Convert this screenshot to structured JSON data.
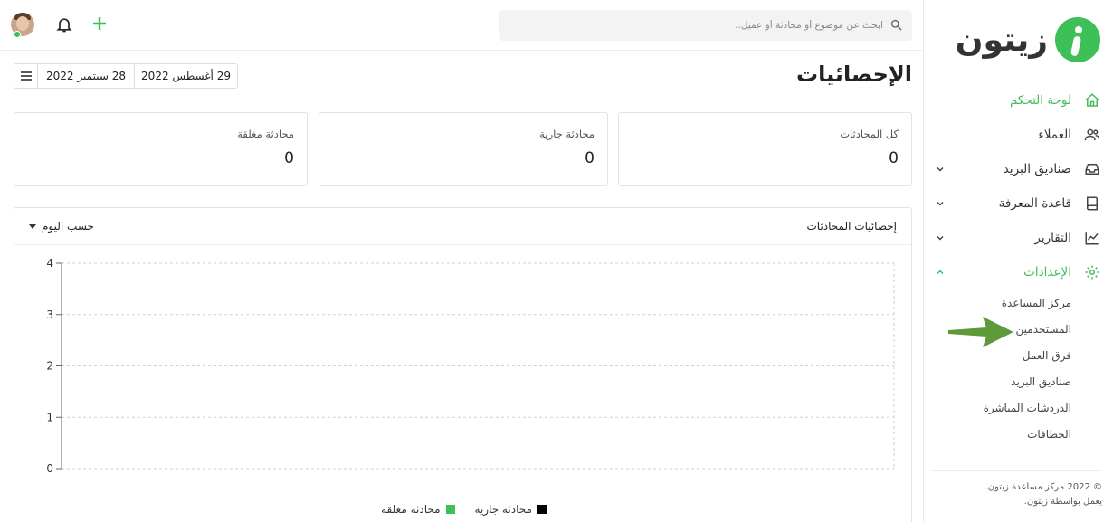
{
  "brand": {
    "name": "زيتون",
    "accent": "#3fbf57"
  },
  "topbar": {
    "search_placeholder": "ابحث عن موضوع أو محادثة أو عميل..",
    "icons": [
      "search-icon",
      "bell-icon",
      "plus-icon"
    ]
  },
  "sidebar": {
    "items": [
      {
        "label": "لوحة التحكم",
        "icon": "home-icon",
        "active": true
      },
      {
        "label": "العملاء",
        "icon": "users-icon"
      },
      {
        "label": "صناديق البريد",
        "icon": "inbox-icon"
      },
      {
        "label": "قاعدة المعرفة",
        "icon": "book-icon"
      },
      {
        "label": "التقارير",
        "icon": "chart-line-icon"
      },
      {
        "label": "الإعدادات",
        "icon": "gear-icon"
      }
    ],
    "settings_sub": [
      "مركز المساعدة",
      "المستخدمين",
      "فرق العمل",
      "صناديق البريد",
      "الدردشات المباشرة",
      "الخطافات"
    ],
    "footer_line1": "© 2022 مركز مساعدة زيتون.",
    "footer_line2": "يعمل بواسطة زيتون."
  },
  "page": {
    "title": "الإحصائيات",
    "date_from": "29 أغسطس 2022",
    "date_to": "28 سبتمبر 2022"
  },
  "stats": [
    {
      "label": "كل المحادثات",
      "value": "0"
    },
    {
      "label": "محادثة جارية",
      "value": "0"
    },
    {
      "label": "محادثة مغلقة",
      "value": "0"
    }
  ],
  "chart_panel": {
    "title": "إحصائيات المحادثات",
    "period": "حسب اليوم"
  },
  "chart_data": {
    "type": "bar",
    "title": "",
    "ylim": [
      0,
      4
    ],
    "yticks": [
      "0",
      "1",
      "2",
      "3",
      "4"
    ],
    "grid": true,
    "legend_placement": "bottom",
    "series": [
      {
        "name": "محادثة جارية",
        "color": "#000000",
        "values": []
      },
      {
        "name": "محادثة مغلقة",
        "color": "#3fbf57",
        "values": []
      }
    ]
  }
}
